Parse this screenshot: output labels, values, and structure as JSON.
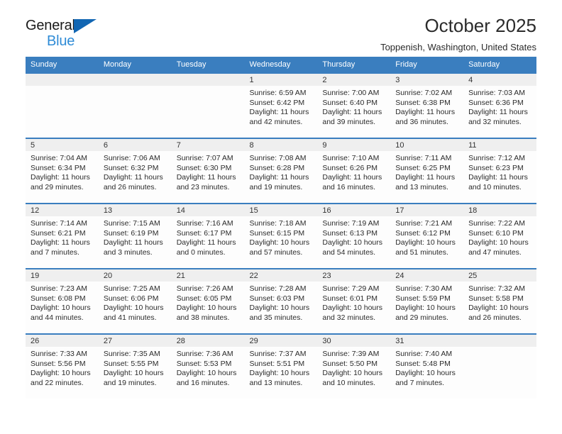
{
  "brand": {
    "line1": "General",
    "line2": "Blue",
    "triangle_color": "#1266b3",
    "line2_color": "#2e8bd6"
  },
  "header": {
    "title": "October 2025",
    "subtitle": "Toppenish, Washington, United States"
  },
  "theme": {
    "header_blue": "#3a7ebf",
    "daynum_band": "#efefef",
    "cell_bg": "#fdfdfd"
  },
  "columns": [
    "Sunday",
    "Monday",
    "Tuesday",
    "Wednesday",
    "Thursday",
    "Friday",
    "Saturday"
  ],
  "labels": {
    "sunrise_prefix": "Sunrise: ",
    "sunset_prefix": "Sunset: ",
    "daylight_prefix": "Daylight: "
  },
  "weeks": [
    [
      {
        "day": "",
        "sunrise": "",
        "sunset": "",
        "daylight": ""
      },
      {
        "day": "",
        "sunrise": "",
        "sunset": "",
        "daylight": ""
      },
      {
        "day": "",
        "sunrise": "",
        "sunset": "",
        "daylight": ""
      },
      {
        "day": "1",
        "sunrise": "Sunrise: 6:59 AM",
        "sunset": "Sunset: 6:42 PM",
        "daylight": "Daylight: 11 hours and 42 minutes."
      },
      {
        "day": "2",
        "sunrise": "Sunrise: 7:00 AM",
        "sunset": "Sunset: 6:40 PM",
        "daylight": "Daylight: 11 hours and 39 minutes."
      },
      {
        "day": "3",
        "sunrise": "Sunrise: 7:02 AM",
        "sunset": "Sunset: 6:38 PM",
        "daylight": "Daylight: 11 hours and 36 minutes."
      },
      {
        "day": "4",
        "sunrise": "Sunrise: 7:03 AM",
        "sunset": "Sunset: 6:36 PM",
        "daylight": "Daylight: 11 hours and 32 minutes."
      }
    ],
    [
      {
        "day": "5",
        "sunrise": "Sunrise: 7:04 AM",
        "sunset": "Sunset: 6:34 PM",
        "daylight": "Daylight: 11 hours and 29 minutes."
      },
      {
        "day": "6",
        "sunrise": "Sunrise: 7:06 AM",
        "sunset": "Sunset: 6:32 PM",
        "daylight": "Daylight: 11 hours and 26 minutes."
      },
      {
        "day": "7",
        "sunrise": "Sunrise: 7:07 AM",
        "sunset": "Sunset: 6:30 PM",
        "daylight": "Daylight: 11 hours and 23 minutes."
      },
      {
        "day": "8",
        "sunrise": "Sunrise: 7:08 AM",
        "sunset": "Sunset: 6:28 PM",
        "daylight": "Daylight: 11 hours and 19 minutes."
      },
      {
        "day": "9",
        "sunrise": "Sunrise: 7:10 AM",
        "sunset": "Sunset: 6:26 PM",
        "daylight": "Daylight: 11 hours and 16 minutes."
      },
      {
        "day": "10",
        "sunrise": "Sunrise: 7:11 AM",
        "sunset": "Sunset: 6:25 PM",
        "daylight": "Daylight: 11 hours and 13 minutes."
      },
      {
        "day": "11",
        "sunrise": "Sunrise: 7:12 AM",
        "sunset": "Sunset: 6:23 PM",
        "daylight": "Daylight: 11 hours and 10 minutes."
      }
    ],
    [
      {
        "day": "12",
        "sunrise": "Sunrise: 7:14 AM",
        "sunset": "Sunset: 6:21 PM",
        "daylight": "Daylight: 11 hours and 7 minutes."
      },
      {
        "day": "13",
        "sunrise": "Sunrise: 7:15 AM",
        "sunset": "Sunset: 6:19 PM",
        "daylight": "Daylight: 11 hours and 3 minutes."
      },
      {
        "day": "14",
        "sunrise": "Sunrise: 7:16 AM",
        "sunset": "Sunset: 6:17 PM",
        "daylight": "Daylight: 11 hours and 0 minutes."
      },
      {
        "day": "15",
        "sunrise": "Sunrise: 7:18 AM",
        "sunset": "Sunset: 6:15 PM",
        "daylight": "Daylight: 10 hours and 57 minutes."
      },
      {
        "day": "16",
        "sunrise": "Sunrise: 7:19 AM",
        "sunset": "Sunset: 6:13 PM",
        "daylight": "Daylight: 10 hours and 54 minutes."
      },
      {
        "day": "17",
        "sunrise": "Sunrise: 7:21 AM",
        "sunset": "Sunset: 6:12 PM",
        "daylight": "Daylight: 10 hours and 51 minutes."
      },
      {
        "day": "18",
        "sunrise": "Sunrise: 7:22 AM",
        "sunset": "Sunset: 6:10 PM",
        "daylight": "Daylight: 10 hours and 47 minutes."
      }
    ],
    [
      {
        "day": "19",
        "sunrise": "Sunrise: 7:23 AM",
        "sunset": "Sunset: 6:08 PM",
        "daylight": "Daylight: 10 hours and 44 minutes."
      },
      {
        "day": "20",
        "sunrise": "Sunrise: 7:25 AM",
        "sunset": "Sunset: 6:06 PM",
        "daylight": "Daylight: 10 hours and 41 minutes."
      },
      {
        "day": "21",
        "sunrise": "Sunrise: 7:26 AM",
        "sunset": "Sunset: 6:05 PM",
        "daylight": "Daylight: 10 hours and 38 minutes."
      },
      {
        "day": "22",
        "sunrise": "Sunrise: 7:28 AM",
        "sunset": "Sunset: 6:03 PM",
        "daylight": "Daylight: 10 hours and 35 minutes."
      },
      {
        "day": "23",
        "sunrise": "Sunrise: 7:29 AM",
        "sunset": "Sunset: 6:01 PM",
        "daylight": "Daylight: 10 hours and 32 minutes."
      },
      {
        "day": "24",
        "sunrise": "Sunrise: 7:30 AM",
        "sunset": "Sunset: 5:59 PM",
        "daylight": "Daylight: 10 hours and 29 minutes."
      },
      {
        "day": "25",
        "sunrise": "Sunrise: 7:32 AM",
        "sunset": "Sunset: 5:58 PM",
        "daylight": "Daylight: 10 hours and 26 minutes."
      }
    ],
    [
      {
        "day": "26",
        "sunrise": "Sunrise: 7:33 AM",
        "sunset": "Sunset: 5:56 PM",
        "daylight": "Daylight: 10 hours and 22 minutes."
      },
      {
        "day": "27",
        "sunrise": "Sunrise: 7:35 AM",
        "sunset": "Sunset: 5:55 PM",
        "daylight": "Daylight: 10 hours and 19 minutes."
      },
      {
        "day": "28",
        "sunrise": "Sunrise: 7:36 AM",
        "sunset": "Sunset: 5:53 PM",
        "daylight": "Daylight: 10 hours and 16 minutes."
      },
      {
        "day": "29",
        "sunrise": "Sunrise: 7:37 AM",
        "sunset": "Sunset: 5:51 PM",
        "daylight": "Daylight: 10 hours and 13 minutes."
      },
      {
        "day": "30",
        "sunrise": "Sunrise: 7:39 AM",
        "sunset": "Sunset: 5:50 PM",
        "daylight": "Daylight: 10 hours and 10 minutes."
      },
      {
        "day": "31",
        "sunrise": "Sunrise: 7:40 AM",
        "sunset": "Sunset: 5:48 PM",
        "daylight": "Daylight: 10 hours and 7 minutes."
      },
      {
        "day": "",
        "sunrise": "",
        "sunset": "",
        "daylight": ""
      }
    ]
  ]
}
